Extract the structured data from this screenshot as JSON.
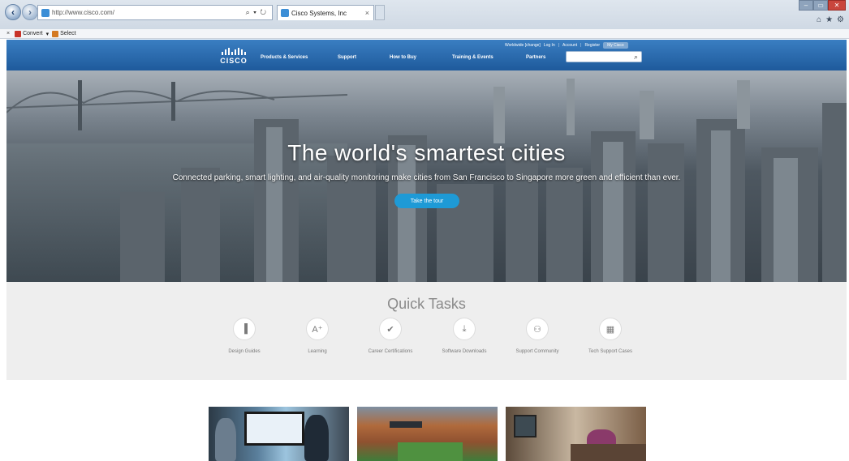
{
  "browser": {
    "url": "http://www.cisco.com/",
    "address_controls": "⌕ ▾ ↻",
    "tab_title": "Cisco Systems, Inc",
    "tab_close": "×",
    "command_bar": {
      "close": "×",
      "convert": "Convert",
      "convert_arrow": "▾",
      "select": "Select"
    }
  },
  "header": {
    "logo_text": "CISCO",
    "nav": [
      "Products & Services",
      "Support",
      "How to Buy",
      "Training & Events",
      "Partners"
    ],
    "util": {
      "worldwide": "Worldwide [change]",
      "login": "Log In",
      "sep": "|",
      "account": "Account",
      "register": "Register",
      "mycisco": "My Cisco"
    },
    "search_placeholder": ""
  },
  "hero": {
    "title": "The world's smartest cities",
    "subtitle": "Connected parking, smart lighting, and air-quality monitoring make cities from San Francisco to Singapore more green and efficient than ever.",
    "cta": "Take the tour"
  },
  "quick_tasks": {
    "title": "Quick Tasks",
    "items": [
      {
        "label": "Design Guides",
        "icon": "document-icon",
        "glyph": "▐"
      },
      {
        "label": "Learning",
        "icon": "learning-icon",
        "glyph": "A⁺"
      },
      {
        "label": "Career Certifications",
        "icon": "certification-icon",
        "glyph": "✔"
      },
      {
        "label": "Software Downloads",
        "icon": "download-icon",
        "glyph": "⤓"
      },
      {
        "label": "Support Community",
        "icon": "community-icon",
        "glyph": "⚇"
      },
      {
        "label": "Tech Support Cases",
        "icon": "briefcase-icon",
        "glyph": "▦"
      }
    ]
  },
  "colors": {
    "header_blue": "#1e5a9c",
    "cta_blue": "#1e9ad6",
    "quick_tasks_bg": "#eeeeee"
  }
}
